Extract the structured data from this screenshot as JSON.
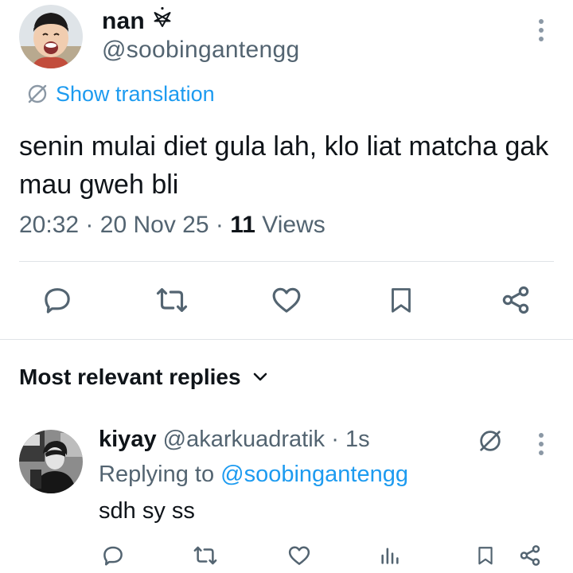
{
  "tweet": {
    "author": {
      "name": "nan",
      "badge_icon": "pentagram-icon",
      "handle": "@soobingantengg"
    },
    "translate_label": "Show translation",
    "text": "senin mulai diet gula lah, klo liat matcha gak mau gweh bli",
    "meta": {
      "time": "20:32",
      "date": "20 Nov 25",
      "views_count": "11",
      "views_label": "Views",
      "separator": "·"
    },
    "actions": [
      "reply-icon",
      "retweet-icon",
      "like-icon",
      "bookmark-icon",
      "share-icon"
    ]
  },
  "replies": {
    "heading": "Most relevant replies",
    "items": [
      {
        "name": "kiyay",
        "handle": "@akarkuadratik",
        "separator": "·",
        "time": "1s",
        "replying_label": "Replying to",
        "replying_to": "@soobingantengg",
        "text": "sdh sy ss",
        "actions": [
          "reply-icon",
          "retweet-icon",
          "like-icon",
          "analytics-icon",
          "bookmark-icon",
          "share-icon"
        ]
      }
    ]
  },
  "colors": {
    "text": "#0f1419",
    "secondary": "#536471",
    "accent": "#1d9bf0",
    "divider": "#dfe3e7"
  }
}
